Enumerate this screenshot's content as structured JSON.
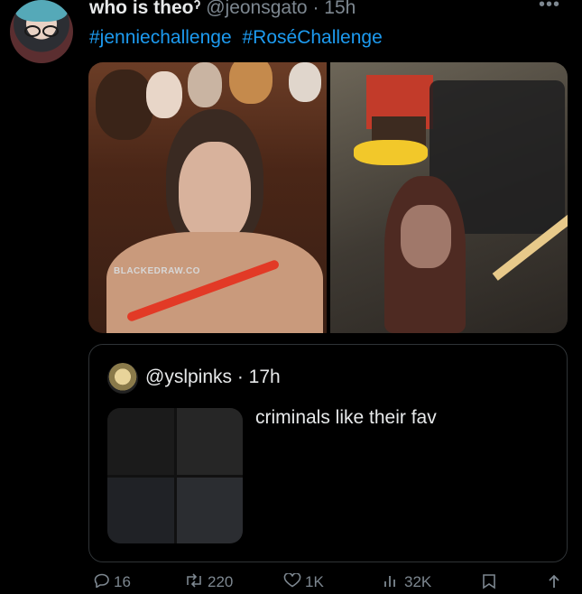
{
  "tweet": {
    "display_name": "who is theoˀ",
    "handle_time": "@jeonsgato · 15h",
    "hashtags": [
      "#jenniechallenge",
      "#RoséChallenge"
    ],
    "media_watermark": "BLACKEDRAW.CO"
  },
  "quote": {
    "handle_time": "@yslpinks · 17h",
    "text": "criminals like their fav"
  },
  "actions": {
    "reply_count": "16",
    "retweet_count": "220",
    "like_count": "1K",
    "views_count": "32K"
  },
  "icons": {
    "more": "more-icon",
    "reply": "reply-icon",
    "retweet": "retweet-icon",
    "like": "heart-icon",
    "views": "views-icon",
    "bookmark": "bookmark-icon",
    "share": "share-icon"
  },
  "colors": {
    "link": "#1d9bf0",
    "muted": "#7d8790",
    "text": "#e7e9ea"
  }
}
